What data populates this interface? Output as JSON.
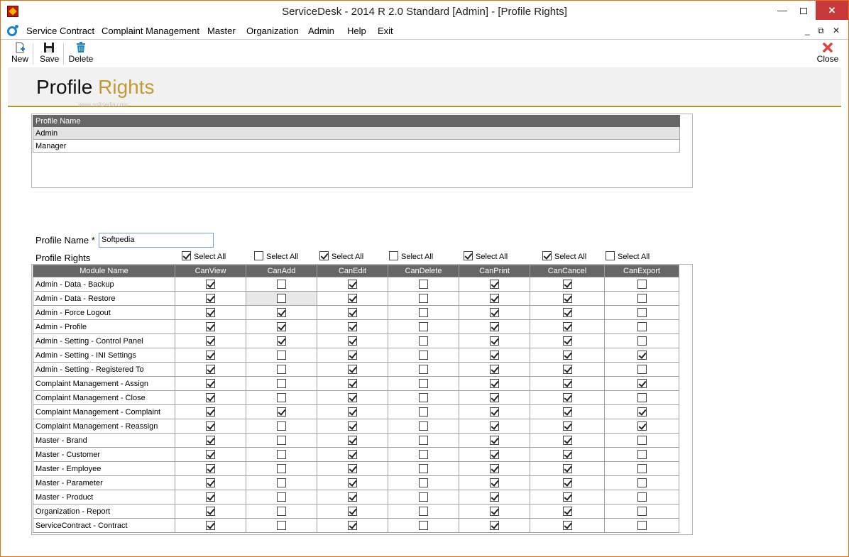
{
  "window": {
    "title": "ServiceDesk - 2014 R 2.0 Standard [Admin] - [Profile Rights]",
    "controls": {
      "minimize": "—",
      "restore": "",
      "close": "✕"
    }
  },
  "menu": {
    "items": [
      "Service Contract",
      "Complaint Management",
      "Master",
      "Organization",
      "Admin",
      "Help",
      "Exit"
    ],
    "mdi": {
      "minimize": "_",
      "restore": "⧉",
      "close": "✕"
    }
  },
  "toolbar": {
    "new_label": "New",
    "save_label": "Save",
    "delete_label": "Delete",
    "close_label": "Close"
  },
  "page": {
    "title_main": "Profile ",
    "title_accent": "Rights",
    "watermark": "www.softpedia.com"
  },
  "profiles": {
    "header": "Profile Name",
    "rows": [
      "Admin",
      "Manager"
    ],
    "selected_index": 0
  },
  "form": {
    "profile_name_label": "Profile Name *",
    "profile_name_value": "Softpedia",
    "profile_rights_label": "Profile Rights"
  },
  "select_all": {
    "label": "Select All",
    "states": [
      true,
      false,
      true,
      false,
      true,
      true,
      false
    ]
  },
  "rights": {
    "columns": [
      "Module Name",
      "CanView",
      "CanAdd",
      "CanEdit",
      "CanDelete",
      "CanPrint",
      "CanCancel",
      "CanExport"
    ],
    "rows": [
      {
        "module": "Admin - Data - Backup",
        "checks": [
          true,
          false,
          true,
          false,
          true,
          true,
          false
        ]
      },
      {
        "module": "Admin - Data - Restore",
        "checks": [
          true,
          false,
          true,
          false,
          true,
          true,
          false
        ]
      },
      {
        "module": "Admin - Force Logout",
        "checks": [
          true,
          true,
          true,
          false,
          true,
          true,
          false
        ]
      },
      {
        "module": "Admin - Profile",
        "checks": [
          true,
          true,
          true,
          false,
          true,
          true,
          false
        ]
      },
      {
        "module": "Admin - Setting - Control Panel",
        "checks": [
          true,
          true,
          true,
          false,
          true,
          true,
          false
        ]
      },
      {
        "module": "Admin - Setting - INI Settings",
        "checks": [
          true,
          false,
          true,
          false,
          true,
          true,
          true
        ]
      },
      {
        "module": "Admin - Setting - Registered To",
        "checks": [
          true,
          false,
          true,
          false,
          true,
          true,
          false
        ]
      },
      {
        "module": "Complaint Management - Assign",
        "checks": [
          true,
          false,
          true,
          false,
          true,
          true,
          true
        ]
      },
      {
        "module": "Complaint Management - Close",
        "checks": [
          true,
          false,
          true,
          false,
          true,
          true,
          false
        ]
      },
      {
        "module": "Complaint Management - Complaint",
        "checks": [
          true,
          true,
          true,
          false,
          true,
          true,
          true
        ]
      },
      {
        "module": "Complaint Management - Reassign",
        "checks": [
          true,
          false,
          true,
          false,
          true,
          true,
          true
        ]
      },
      {
        "module": "Master - Brand",
        "checks": [
          true,
          false,
          true,
          false,
          true,
          true,
          false
        ]
      },
      {
        "module": "Master - Customer",
        "checks": [
          true,
          false,
          true,
          false,
          true,
          true,
          false
        ]
      },
      {
        "module": "Master - Employee",
        "checks": [
          true,
          false,
          true,
          false,
          true,
          true,
          false
        ]
      },
      {
        "module": "Master - Parameter",
        "checks": [
          true,
          false,
          true,
          false,
          true,
          true,
          false
        ]
      },
      {
        "module": "Master - Product",
        "checks": [
          true,
          false,
          true,
          false,
          true,
          true,
          false
        ]
      },
      {
        "module": "Organization - Report",
        "checks": [
          true,
          false,
          true,
          false,
          true,
          true,
          false
        ]
      },
      {
        "module": "ServiceContract - Contract",
        "checks": [
          true,
          false,
          true,
          false,
          true,
          true,
          false
        ]
      }
    ]
  }
}
